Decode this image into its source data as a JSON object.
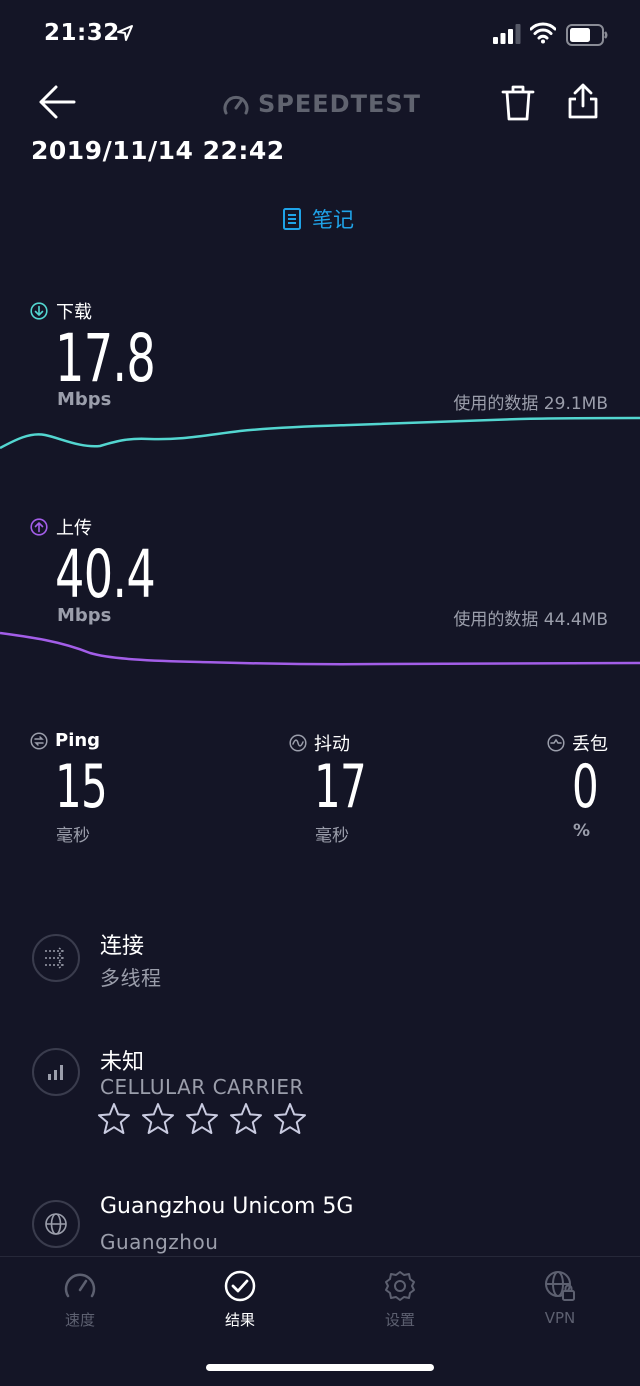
{
  "status_bar": {
    "time": "21:32"
  },
  "header": {
    "brand": "SPEEDTEST",
    "datetime": "2019/11/14 22:42",
    "notes_label": "笔记"
  },
  "download": {
    "label": "下载",
    "value": "17.8",
    "unit": "Mbps",
    "data_used": "使用的数据 29.1MB",
    "color": "#53d6d0"
  },
  "upload": {
    "label": "上传",
    "value": "40.4",
    "unit": "Mbps",
    "data_used": "使用的数据 44.4MB",
    "color": "#a35ee8"
  },
  "stats": {
    "ping": {
      "label": "Ping",
      "value": "15",
      "unit": "毫秒"
    },
    "jitter": {
      "label": "抖动",
      "value": "17",
      "unit": "毫秒"
    },
    "loss": {
      "label": "丢包",
      "value": "0",
      "unit": "%"
    }
  },
  "connection": {
    "title": "连接",
    "sub": "多线程"
  },
  "carrier": {
    "title": "未知",
    "sub": "CELLULAR CARRIER",
    "rating_stars": 5,
    "rating_filled": 0
  },
  "server": {
    "title": "Guangzhou Unicom 5G",
    "sub": "Guangzhou"
  },
  "tabs": [
    {
      "label": "速度",
      "icon": "speed-gauge-icon"
    },
    {
      "label": "结果",
      "icon": "check-circle-icon",
      "active": true
    },
    {
      "label": "设置",
      "icon": "gear-icon"
    },
    {
      "label": "VPN",
      "icon": "vpn-globe-lock-icon"
    }
  ],
  "colors": {
    "background": "#141526",
    "accent_blue": "#1fa3e8",
    "muted": "#9b9eab"
  }
}
